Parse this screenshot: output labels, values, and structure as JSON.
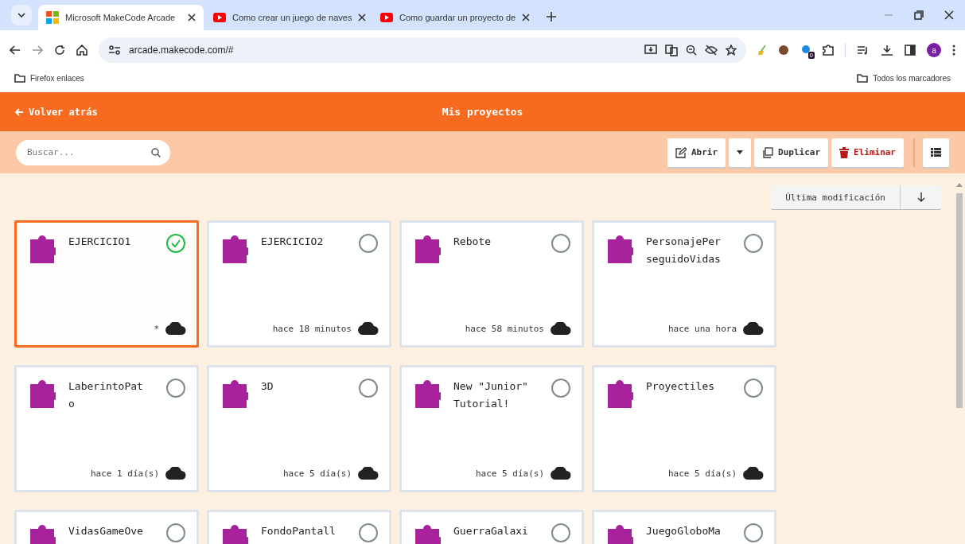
{
  "browser": {
    "tabs": [
      {
        "title": "Microsoft MakeCode Arcade",
        "kind": "makecode",
        "selected": true
      },
      {
        "title": "Como crear un juego de naves",
        "kind": "youtube",
        "selected": false
      },
      {
        "title": "Como guardar un proyecto de",
        "kind": "youtube",
        "selected": false
      }
    ],
    "url": "arcade.makecode.com/#",
    "extension_badge": "0",
    "profile": "a",
    "bookmarks": [
      "Firefox enlaces"
    ],
    "all_bookmarks": "Todos los marcadores"
  },
  "header": {
    "back": "Volver atrás",
    "title": "Mis proyectos"
  },
  "toolbar": {
    "search_placeholder": "Buscar...",
    "open": "Abrir",
    "duplicate": "Duplicar",
    "delete": "Eliminar"
  },
  "sort": {
    "label": "Última modificación"
  },
  "projects": [
    {
      "title": "EJERCICIO1",
      "time": "*",
      "selected": true
    },
    {
      "title": "EJERCICIO2",
      "time": "hace 18 minutos",
      "selected": false
    },
    {
      "title": "Rebote",
      "time": "hace 58 minutos",
      "selected": false
    },
    {
      "title": "PersonajePerseguidoVidas",
      "time": "hace una hora",
      "selected": false
    },
    {
      "title": "LaberintoPato",
      "time": "hace 1 día(s)",
      "selected": false
    },
    {
      "title": "3D",
      "time": "hace 5 día(s)",
      "selected": false
    },
    {
      "title": "New \"Junior\" Tutorial!",
      "time": "hace 5 día(s)",
      "selected": false
    },
    {
      "title": "Proyectiles",
      "time": "hace 5 día(s)",
      "selected": false
    },
    {
      "title": "VidasGameOve",
      "selected": false
    },
    {
      "title": "FondoPantall",
      "selected": false
    },
    {
      "title": "GuerraGalaxi",
      "selected": false
    },
    {
      "title": "JuegoGloboMa",
      "selected": false
    }
  ]
}
